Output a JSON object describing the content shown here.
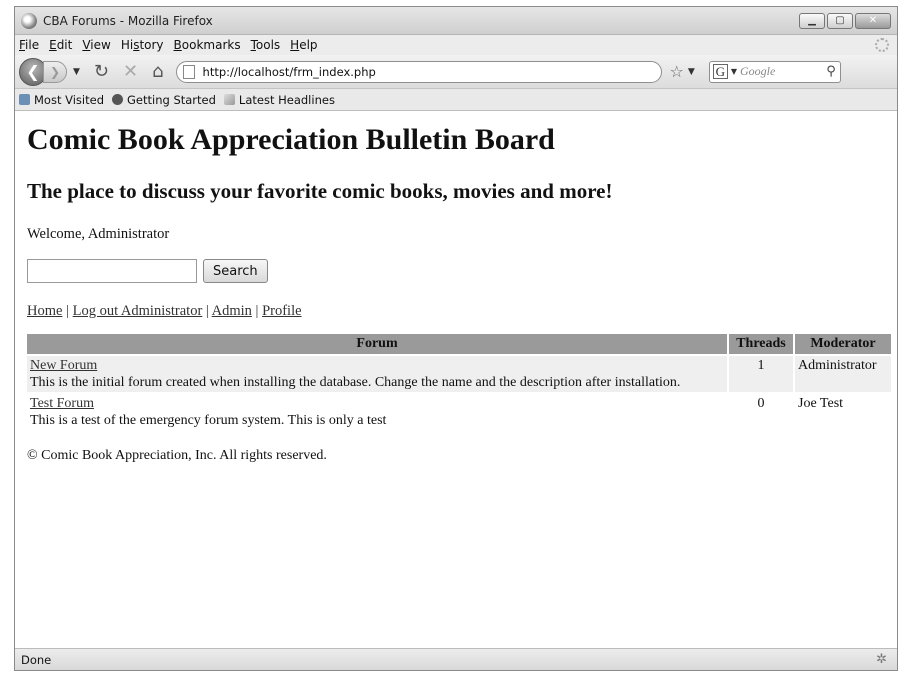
{
  "window": {
    "title": "CBA Forums - Mozilla Firefox",
    "controls": [
      "minimize",
      "maximize",
      "close"
    ]
  },
  "menu": [
    {
      "accel": "F",
      "rest": "ile"
    },
    {
      "accel": "E",
      "rest": "dit"
    },
    {
      "accel": "V",
      "rest": "iew"
    },
    {
      "pre": "Hi",
      "accel": "s",
      "rest": "tory"
    },
    {
      "accel": "B",
      "rest": "ookmarks"
    },
    {
      "accel": "T",
      "rest": "ools"
    },
    {
      "accel": "H",
      "rest": "elp"
    }
  ],
  "nav": {
    "url": "http://localhost/frm_index.php",
    "search_placeholder": "Google",
    "icons": [
      "back-icon",
      "forward-icon",
      "history-dropdown-icon",
      "reload-icon",
      "stop-icon",
      "home-icon",
      "page-icon",
      "bookmark-star-icon",
      "google-icon",
      "magnifier-icon"
    ]
  },
  "bookmarks": [
    "Most Visited",
    "Getting Started",
    "Latest Headlines"
  ],
  "page": {
    "heading": "Comic Book Appreciation Bulletin Board",
    "subheading": "The place to discuss your favorite comic books, movies and more!",
    "welcome": "Welcome, Administrator",
    "search_button": "Search",
    "nav_links": [
      "Home",
      "Log out Administrator",
      "Admin",
      "Profile"
    ],
    "table": {
      "headers": [
        "Forum",
        "Threads",
        "Moderator"
      ],
      "rows": [
        {
          "name": "New Forum",
          "description": "This is the initial forum created when installing the database. Change the name and the description after installation.",
          "threads": "1",
          "moderator": "Administrator"
        },
        {
          "name": "Test Forum",
          "description": "This is a test of the emergency forum system. This is only a test",
          "threads": "0",
          "moderator": "Joe Test"
        }
      ]
    },
    "footer": "© Comic Book Appreciation, Inc. All rights reserved."
  },
  "status": {
    "text": "Done"
  }
}
